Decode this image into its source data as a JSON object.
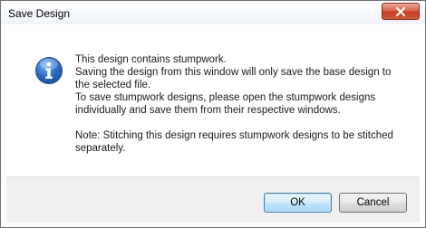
{
  "window": {
    "title": "Save Design"
  },
  "message": {
    "line1": "This design contains stumpwork.",
    "line2": "Saving the design from this window will only save the base design to",
    "line3": "the selected file.",
    "line4": "To save stumpwork designs, please open the stumpwork designs",
    "line5": "individually and save them from their respective windows.",
    "line6": "Note: Stitching this design requires stumpwork designs to be stitched",
    "line7": "separately."
  },
  "buttons": {
    "ok_label": "OK",
    "cancel_label": "Cancel"
  },
  "icons": {
    "message_icon": "information-icon",
    "close_icon": "close-icon"
  },
  "colors": {
    "close_button": "#c8391c",
    "info_icon": "#2a6fc9",
    "ok_border": "#3c7fb1"
  }
}
